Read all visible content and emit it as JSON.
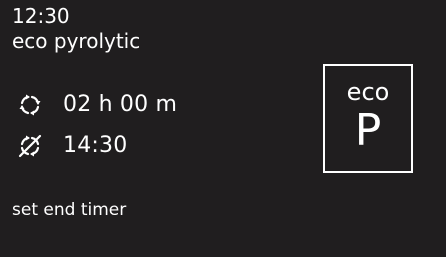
{
  "status": {
    "clock": "12:30",
    "program": "eco pyrolytic"
  },
  "timers": {
    "duration": {
      "icon": "duration-cycle-icon",
      "value": "02 h 00 m"
    },
    "end_time": {
      "icon": "end-time-crossed-icon",
      "value": "14:30"
    }
  },
  "hint": "set end timer",
  "mode_badge": {
    "label": "eco",
    "letter": "P"
  },
  "colors": {
    "background": "#201e1f",
    "foreground": "#ffffff"
  }
}
